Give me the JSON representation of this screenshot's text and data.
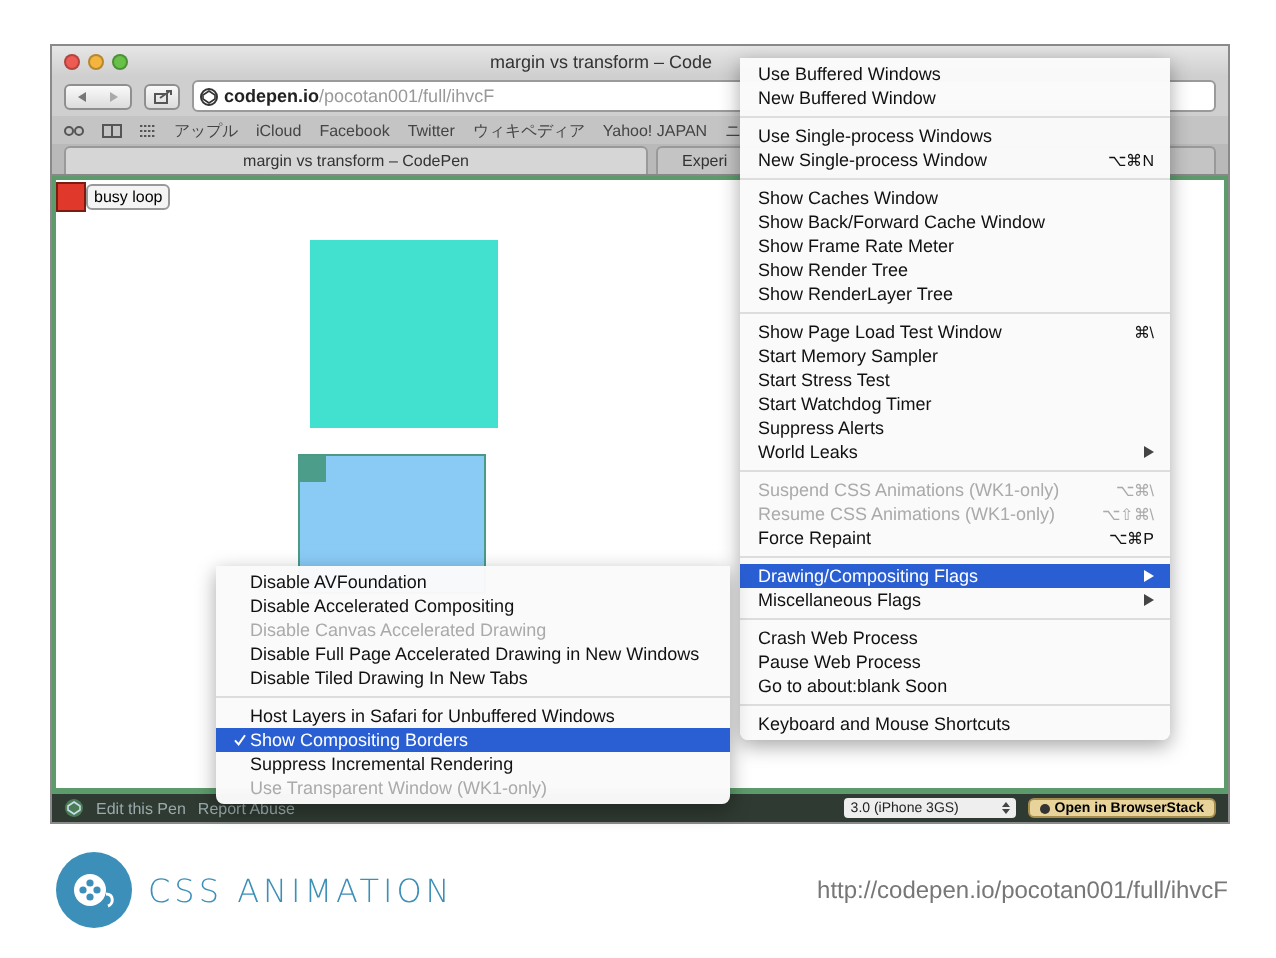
{
  "window": {
    "title": "margin vs transform – Code",
    "address": {
      "host": "codepen.io",
      "path": "/pocotan001/full/ihvcF"
    },
    "bookmarks": [
      "アップル",
      "iCloud",
      "Facebook",
      "Twitter",
      "ウィキペディア",
      "Yahoo! JAPAN",
      "ニ"
    ],
    "tabs": [
      {
        "label": "margin vs transform – CodePen",
        "selected": true
      },
      {
        "label": "Experi",
        "selected": false
      }
    ]
  },
  "page": {
    "button": "busy loop"
  },
  "bottom_bar": {
    "links": [
      "Edit this Pen",
      "Report Abuse"
    ],
    "device_select": "3.0 (iPhone 3GS)",
    "action_button": "Open in BrowserStack"
  },
  "menu": {
    "groups": [
      [
        {
          "label": "Use Buffered Windows",
          "disabled": false,
          "selected": false
        },
        {
          "label": "New Buffered Window",
          "disabled": false,
          "selected": false
        }
      ],
      [
        {
          "label": "Use Single-process Windows",
          "disabled": false,
          "selected": false
        },
        {
          "label": "New Single-process Window",
          "shortcut": "⌥⌘N",
          "disabled": false,
          "selected": false
        }
      ],
      [
        {
          "label": "Show Caches Window",
          "disabled": false,
          "selected": false
        },
        {
          "label": "Show Back/Forward Cache Window",
          "disabled": false,
          "selected": false
        },
        {
          "label": "Show Frame Rate Meter",
          "disabled": false,
          "selected": false
        },
        {
          "label": "Show Render Tree",
          "disabled": false,
          "selected": false
        },
        {
          "label": "Show RenderLayer Tree",
          "disabled": false,
          "selected": false
        }
      ],
      [
        {
          "label": "Show Page Load Test Window",
          "shortcut": "⌘\\",
          "disabled": false,
          "selected": false
        },
        {
          "label": "Start Memory Sampler",
          "disabled": false,
          "selected": false
        },
        {
          "label": "Start Stress Test",
          "disabled": false,
          "selected": false
        },
        {
          "label": "Start Watchdog Timer",
          "disabled": false,
          "selected": false
        },
        {
          "label": "Suppress Alerts",
          "disabled": false,
          "selected": false
        },
        {
          "label": "World Leaks",
          "submenu": true,
          "disabled": false,
          "selected": false
        }
      ],
      [
        {
          "label": "Suspend CSS Animations (WK1-only)",
          "shortcut": "⌥⌘\\",
          "disabled": true,
          "selected": false
        },
        {
          "label": "Resume CSS Animations (WK1-only)",
          "shortcut": "⌥⇧⌘\\",
          "disabled": true,
          "selected": false
        },
        {
          "label": "Force Repaint",
          "shortcut": "⌥⌘P",
          "disabled": false,
          "selected": false
        }
      ],
      [
        {
          "label": "Drawing/Compositing Flags",
          "submenu": true,
          "disabled": false,
          "selected": true
        },
        {
          "label": "Miscellaneous Flags",
          "submenu": true,
          "disabled": false,
          "selected": false
        }
      ],
      [
        {
          "label": "Crash Web Process",
          "disabled": false,
          "selected": false
        },
        {
          "label": "Pause Web Process",
          "disabled": false,
          "selected": false
        },
        {
          "label": "Go to about:blank Soon",
          "disabled": false,
          "selected": false
        }
      ],
      [
        {
          "label": "Keyboard and Mouse Shortcuts",
          "disabled": false,
          "selected": false
        }
      ]
    ]
  },
  "submenu": {
    "groups": [
      [
        {
          "label": "Disable AVFoundation",
          "disabled": false,
          "selected": false,
          "checked": false
        },
        {
          "label": "Disable Accelerated Compositing",
          "disabled": false,
          "selected": false,
          "checked": false
        },
        {
          "label": "Disable Canvas Accelerated Drawing",
          "disabled": true,
          "selected": false,
          "checked": false
        },
        {
          "label": "Disable Full Page Accelerated Drawing in New Windows",
          "disabled": false,
          "selected": false,
          "checked": false
        },
        {
          "label": "Disable Tiled Drawing In New Tabs",
          "disabled": false,
          "selected": false,
          "checked": false
        }
      ],
      [
        {
          "label": "Host Layers in Safari for Unbuffered Windows",
          "disabled": false,
          "selected": false,
          "checked": false
        },
        {
          "label": "Show Compositing Borders",
          "disabled": false,
          "selected": true,
          "checked": true
        },
        {
          "label": "Suppress Incremental Rendering",
          "disabled": false,
          "selected": false,
          "checked": false
        },
        {
          "label": "Use Transparent Window (WK1-only)",
          "disabled": true,
          "selected": false,
          "checked": false
        }
      ]
    ]
  },
  "slide": {
    "title": "CSS ANIMATION",
    "url": "http://codepen.io/pocotan001/full/ihvcF"
  }
}
